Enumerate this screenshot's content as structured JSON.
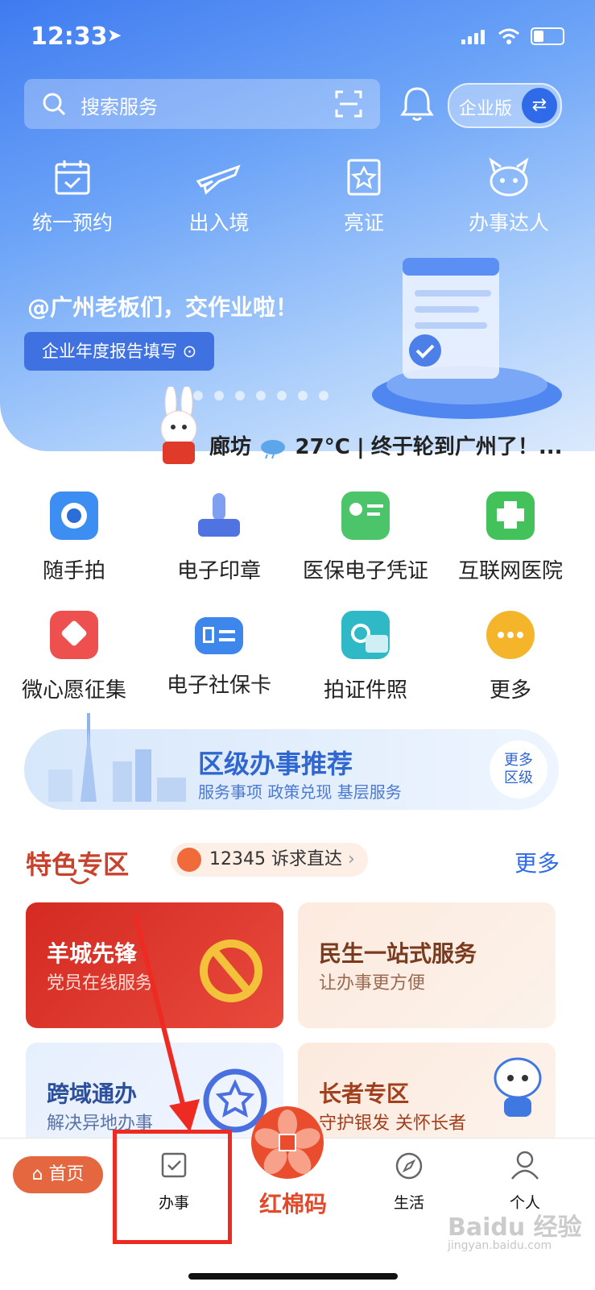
{
  "status": {
    "time": "12:33"
  },
  "search": {
    "placeholder": "搜索服务"
  },
  "enterprise": {
    "label": "企业版"
  },
  "top_nav": [
    {
      "label": "统一预约",
      "icon": "calendar-check-icon"
    },
    {
      "label": "出入境",
      "icon": "airplane-icon"
    },
    {
      "label": "亮证",
      "icon": "certificate-star-icon"
    },
    {
      "label": "办事达人",
      "icon": "mascot-icon"
    }
  ],
  "banner": {
    "title": "@广州老板们，交作业啦！",
    "button": "企业年度报告填写 ⊙"
  },
  "weather": {
    "city": "廊坊",
    "temp": "27°C",
    "sep": "|",
    "news": "终于轮到广州了！..."
  },
  "services": [
    {
      "label": "随手拍",
      "icon": "camera-icon",
      "color": "#3d8ef2"
    },
    {
      "label": "电子印章",
      "icon": "stamp-icon",
      "color": "#5b7fe6"
    },
    {
      "label": "医保电子凭证",
      "icon": "insurance-card-icon",
      "color": "#4cc46a"
    },
    {
      "label": "互联网医院",
      "icon": "hospital-icon",
      "color": "#43c25c"
    },
    {
      "label": "微心愿征集",
      "icon": "wish-heart-icon",
      "color": "#ee4f4f"
    },
    {
      "label": "电子社保卡",
      "icon": "social-security-card-icon",
      "color": "#3d86ec"
    },
    {
      "label": "拍证件照",
      "icon": "id-photo-icon",
      "color": "#2fb9c6"
    },
    {
      "label": "更多",
      "icon": "more-dots-icon",
      "color": "#f5b52a"
    }
  ],
  "district": {
    "title": "区级办事推荐",
    "subtitle": "服务事项  政策兑现  基层服务",
    "more_line1": "更多",
    "more_line2": "区级"
  },
  "featured": {
    "title": "特色专区",
    "hotline": "12345 诉求直达",
    "more": "更多"
  },
  "cards": [
    {
      "title": "羊城先锋",
      "subtitle": "党员在线服务"
    },
    {
      "title": "民生一站式服务",
      "subtitle": "让办事更方便"
    },
    {
      "title": "跨域通办",
      "subtitle": "解决异地办事"
    },
    {
      "title": "长者专区",
      "subtitle": "守护银发 关怀长者"
    }
  ],
  "tabbar": {
    "home": "首页",
    "affairs": "办事",
    "center": "红棉码",
    "life": "生活",
    "personal": "个人"
  },
  "watermark": {
    "brand": "Baidu 经验",
    "url": "jingyan.baidu.com"
  }
}
